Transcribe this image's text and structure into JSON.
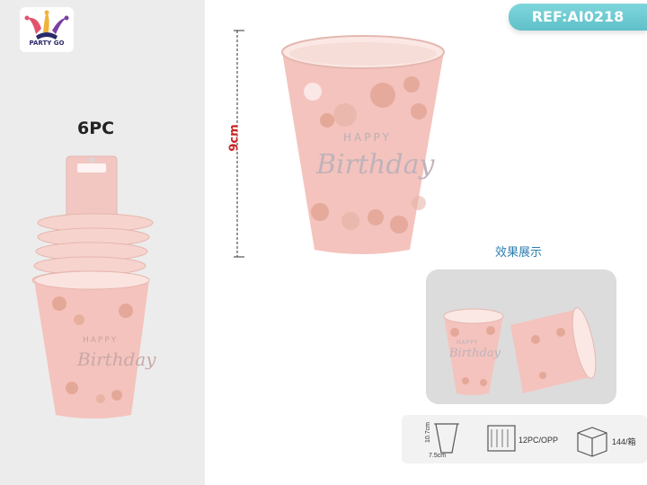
{
  "brand": {
    "logo_text": "PARTY GO"
  },
  "reference": {
    "label": "REF:AI0218"
  },
  "pack": {
    "count_label": "6PC"
  },
  "product": {
    "cup_text_line1": "HAPPY",
    "cup_text_line2": "Birthday",
    "height_label": "9cm"
  },
  "effect": {
    "label": "效果展示"
  },
  "specs": {
    "cup_height": "10.7cm",
    "cup_width": "7.5cm",
    "inner_pack": "12PC/OPP",
    "carton": "144/箱"
  },
  "colors": {
    "cup_pink": "#f4c3bd",
    "rose_gold": "#d9967f",
    "badge": "#6ccbd2",
    "dimension_red": "#cc2222"
  }
}
